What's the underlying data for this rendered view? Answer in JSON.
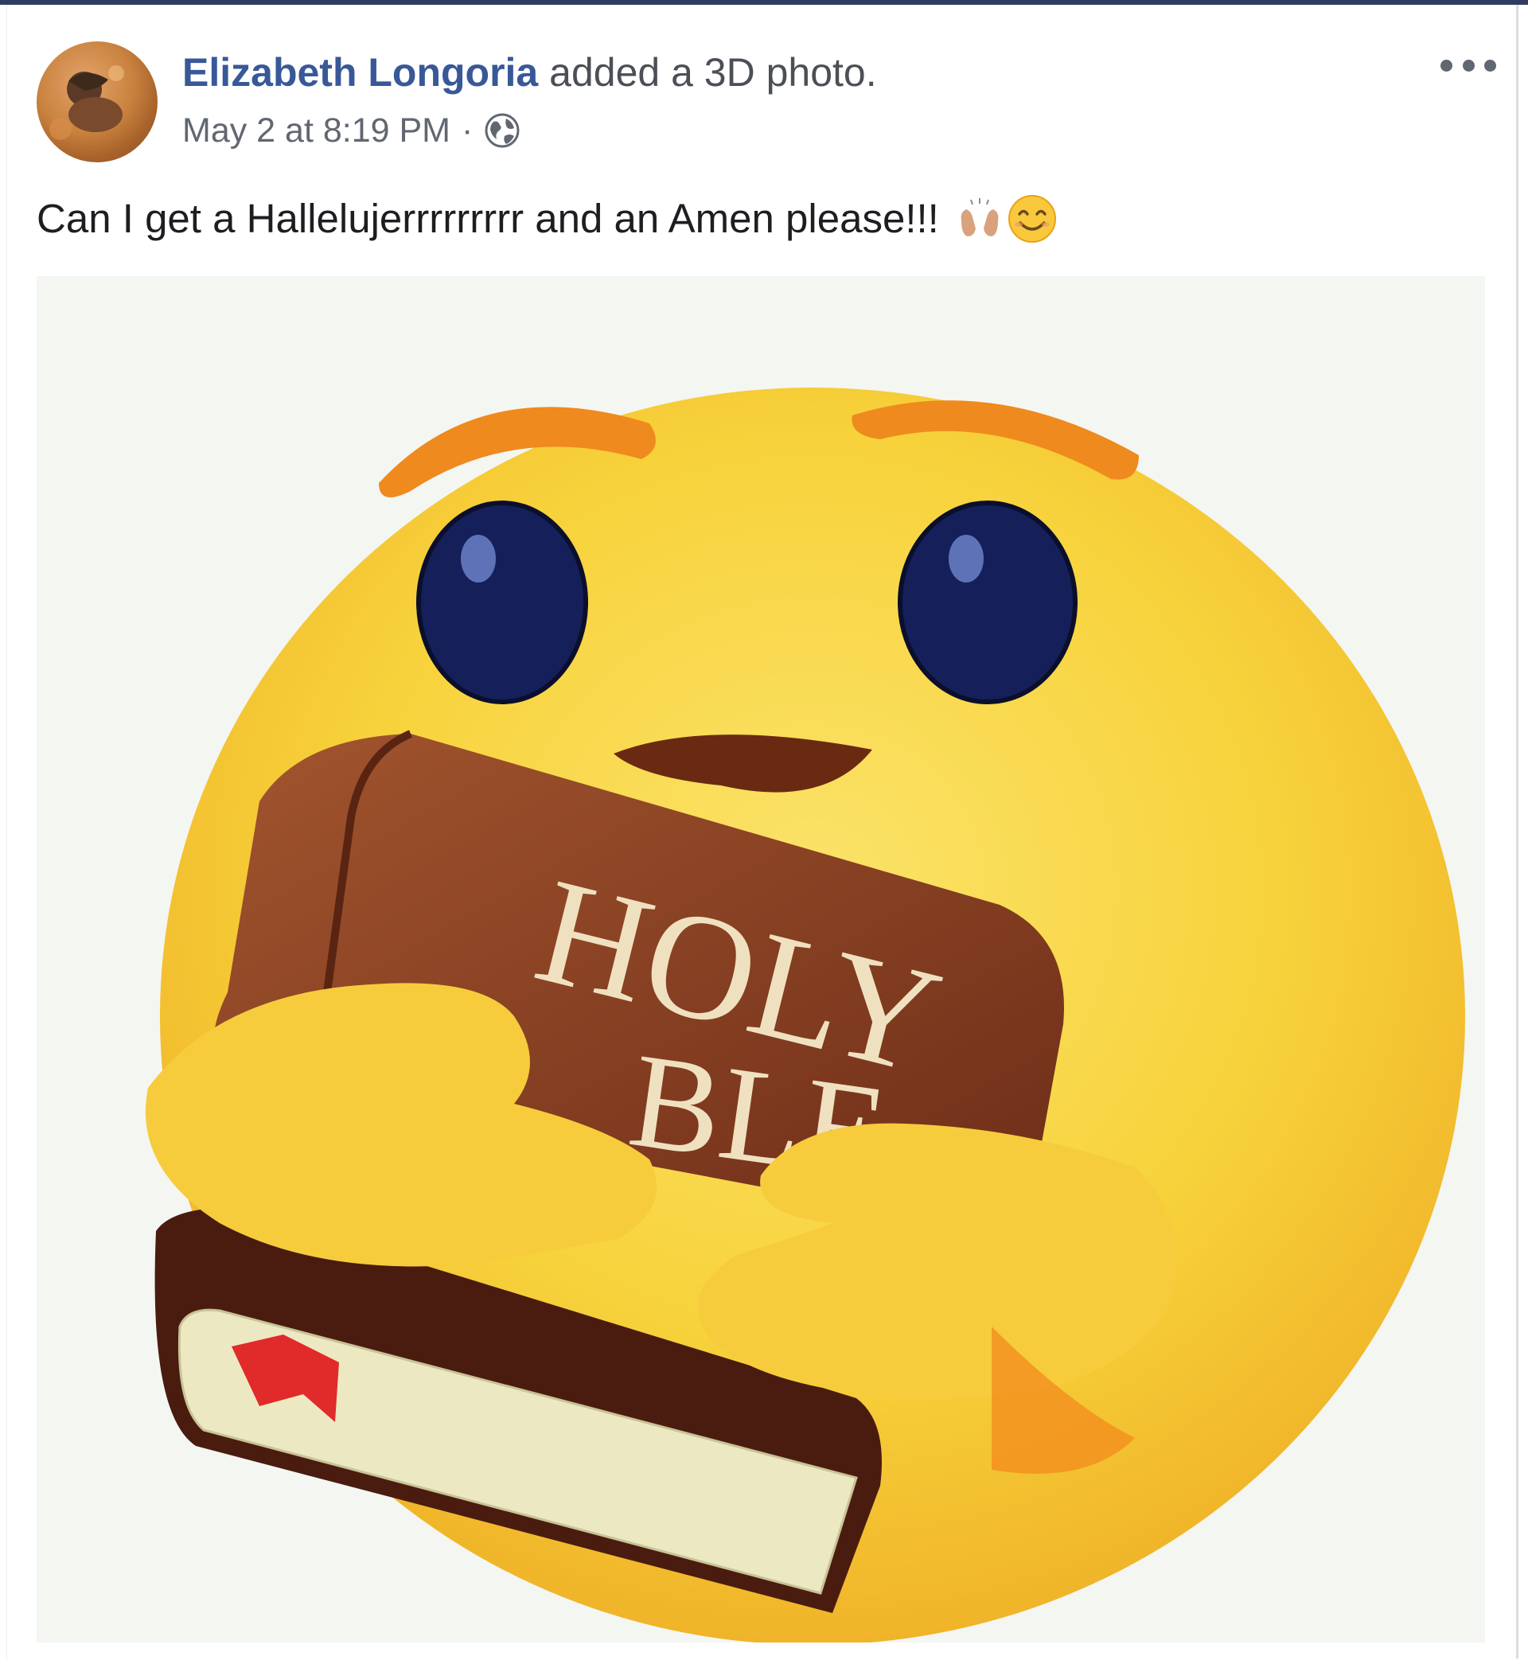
{
  "post": {
    "author_name": "Elizabeth Longoria",
    "action": "added a 3D photo.",
    "timestamp": "May 2 at 8:19 PM",
    "separator": "·",
    "privacy_icon": "globe-icon",
    "more_icon": "more-options-icon",
    "text": "Can I get a Hallelujerrrrrrrrr and an Amen please!!!",
    "text_emojis": [
      "raising-hands-emoji",
      "smiling-face-emoji"
    ]
  },
  "photo": {
    "book_title_line1": "HOLY",
    "book_title_line2": "BLE"
  },
  "colors": {
    "author_link": "#385898",
    "emoji_yellow": "#f7d23b",
    "book_brown": "#8a3f22"
  }
}
